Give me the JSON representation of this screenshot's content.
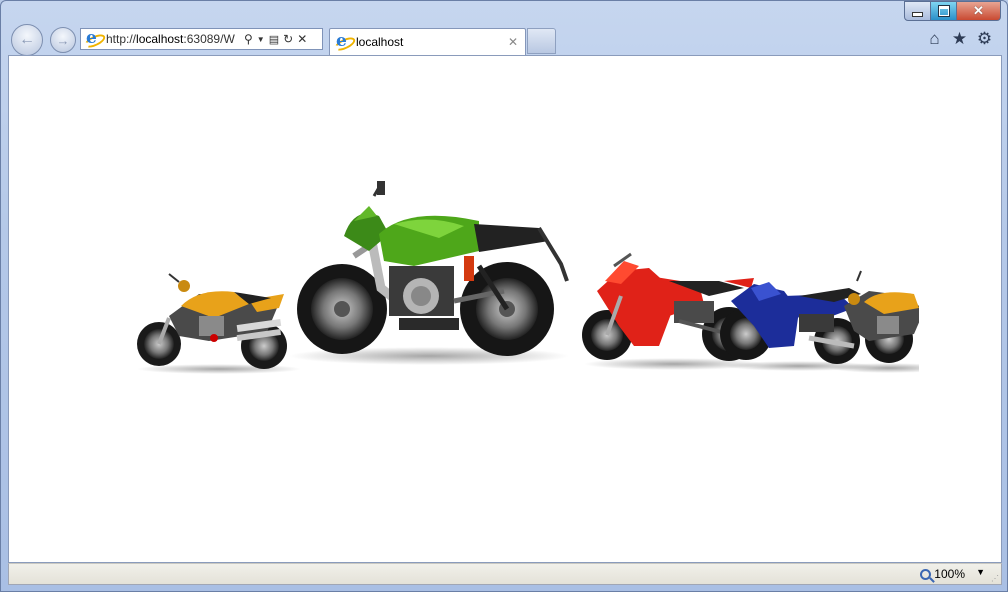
{
  "browser": {
    "address": {
      "prefix": "http://",
      "host": "localhost",
      "rest": ":63089/W"
    },
    "tab": {
      "title": "localhost"
    },
    "zoom": "100%"
  },
  "motorcycles": [
    {
      "name": "orange-naked-bike",
      "color": "#e8a21a"
    },
    {
      "name": "green-naked-bike",
      "color": "#4ea71a"
    },
    {
      "name": "red-sport-bike",
      "color": "#e02218"
    },
    {
      "name": "blue-sport-bike",
      "color": "#1c2d9a"
    },
    {
      "name": "orange-naked-bike-partial",
      "color": "#e8a21a"
    }
  ]
}
